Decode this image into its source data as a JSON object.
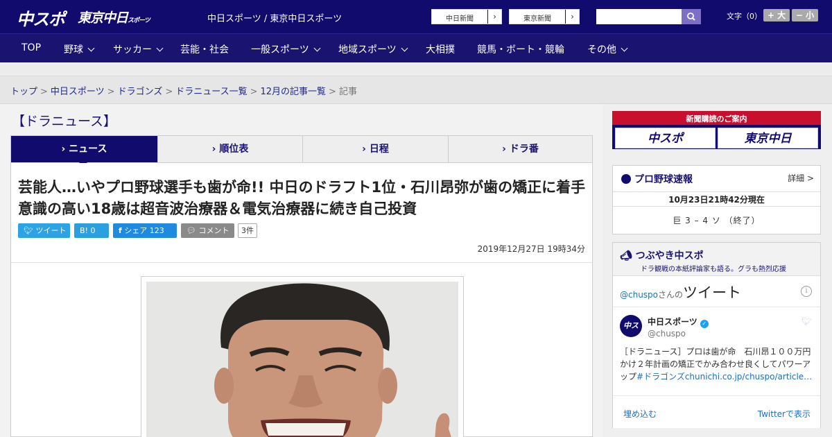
{
  "header": {
    "logo_chunichi_sports": "中スポ",
    "logo_tokyo_chunichi": "東京中日",
    "logo_tokyo_sub": "スポーツ",
    "site_links": "中日スポーツ / 東京中日スポーツ",
    "ext_link_1": "中日新聞",
    "ext_link_2": "東京新聞",
    "ext_arrow": "›",
    "search_placeholder": "",
    "font_size_label": "文字（0）",
    "font_larger": "+ 大",
    "font_smaller": "− 小",
    "accent_color": "#120b6e"
  },
  "nav": {
    "items": [
      "TOP",
      "野球",
      "サッカー",
      "芸能・社会",
      "一般スポーツ",
      "地域スポーツ",
      "大相撲",
      "競馬・ボート・競輪",
      "その他"
    ]
  },
  "breadcrumb": {
    "items": [
      "トップ",
      "中日スポーツ",
      "ドラゴンズ",
      "ドラニュース一覧",
      "12月の記事一覧"
    ],
    "current": "記事",
    "separator": ">"
  },
  "section_title": "【ドラニュース】",
  "tabs": [
    "ニュース",
    "順位表",
    "日程",
    "ドラ番"
  ],
  "article": {
    "headline": "芸能人…いやプロ野球選手も歯が命!! 中日のドラフト1位・石川昂弥が歯の矯正に着手 意識の高い18歳は超音波治療器＆電気治療器に続き自己投資",
    "share_tweet": "ツイート",
    "share_hatena": "B! 0",
    "share_facebook": "シェア 123",
    "share_comment": "コメント",
    "comment_count": "3件",
    "date": "2019年12月27日 19時34分"
  },
  "sidebar": {
    "subscription_title": "新聞購読のご案内",
    "subscription_btn_1": "中スポ",
    "subscription_btn_2": "東京中日",
    "baseball_title": "プロ野球速報",
    "baseball_more": "詳細 >",
    "baseball_time": "10月23日21時42分現在",
    "baseball_score": "巨 3 – 4 ソ （終了）",
    "tweets_title": "つぶやき中スポ",
    "tweets_subtitle": "ドラ観戦の本紙評論家も語る。グラも熱烈応援",
    "tweets_handle": "@chuspo",
    "tweets_handle_suffix": "さんの",
    "tweets_handle_big": "ツイート",
    "tweet_author": "中日スポーツ",
    "tweet_account": "@chuspo",
    "tweet_text": "［ドラニュース］プロは歯が命　石川昂１００万円かけ２年計画の矯正でかみ合わせ良くしてパワーアップ",
    "tweet_link": "#ドラゴンズchunichi.co.jp/chuspo/article…",
    "tweet_embed": "埋め込む",
    "tweet_view": "Twitterで表示"
  }
}
